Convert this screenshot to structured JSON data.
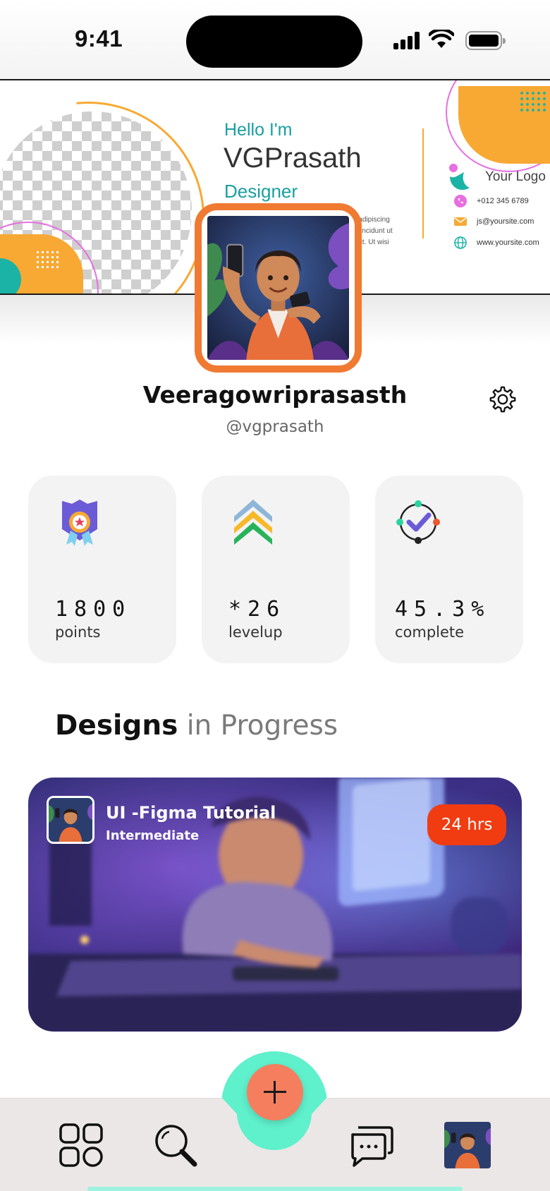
{
  "status_bar": {
    "time": "9:41"
  },
  "banner": {
    "hello": "Hello I'm",
    "name": "VGPrasath",
    "role": "Designer",
    "lorem_lines": [
      "...adipiscing",
      "...tincidunt ut",
      "...ut. Ut wisi"
    ],
    "logo_text": "Your Logo",
    "phone": "+012 345 6789",
    "email": "js@yoursite.com",
    "website": "www.yoursite.com"
  },
  "profile": {
    "name": "Veeragowriprasasth",
    "handle": "@vgprasath"
  },
  "stats": [
    {
      "value": "1800",
      "label": "points",
      "icon": "award-ribbon-icon"
    },
    {
      "value": "*26",
      "label": "levelup",
      "icon": "chevron-levels-icon"
    },
    {
      "value": "45.3%",
      "label": "complete",
      "icon": "target-check-icon"
    }
  ],
  "section": {
    "title_strong": "Designs",
    "title_muted": " in Progress"
  },
  "design_card": {
    "title": "UI -Figma Tutorial",
    "level": "Intermediate",
    "duration": "24 hrs"
  },
  "colors": {
    "accent_orange": "#f07a32",
    "badge_red": "#f13c12",
    "fab_teal": "#5ff0cc",
    "fab_coral": "#f47e5e",
    "banner_teal": "#1a9fa0",
    "banner_yellow": "#f7a933"
  },
  "nav": [
    "grid-icon",
    "search-icon",
    "add-icon",
    "chat-icon",
    "profile-avatar"
  ]
}
